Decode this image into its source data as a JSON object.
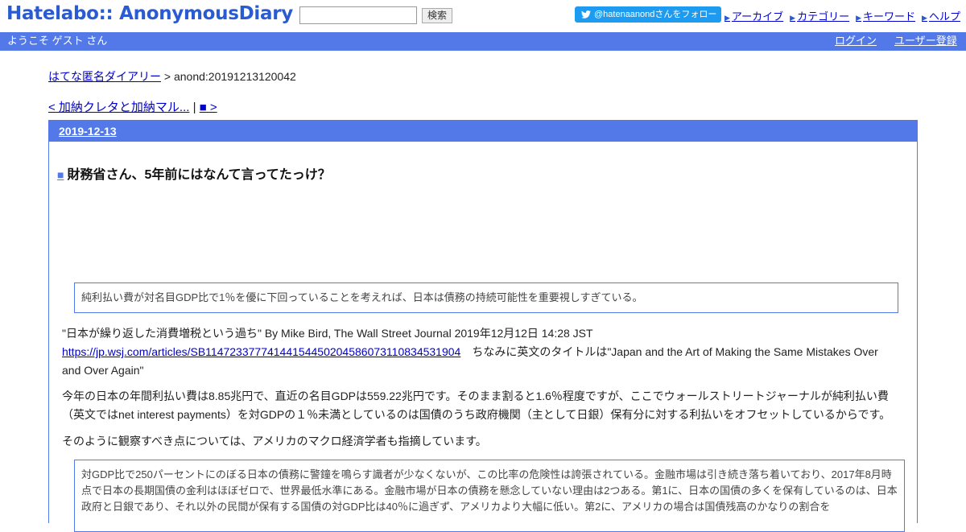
{
  "header": {
    "logo": "Hatelabo:: AnonymousDiary",
    "search_placeholder": "",
    "search_button": "検索",
    "follow_button": "@hatenaanondさんをフォロー",
    "links": [
      "アーカイブ",
      "カテゴリー",
      "キーワード",
      "ヘルプ"
    ]
  },
  "userbar": {
    "welcome": "ようこそ ゲスト さん",
    "login": "ログイン",
    "register": "ユーザー登録"
  },
  "breadcrumb": {
    "home": "はてな匿名ダイアリー",
    "separator": " > ",
    "current": "anond:20191213120042"
  },
  "pager": {
    "prev": "< 加納クレタと加納マル...",
    "separator": " | ",
    "next": "■ >"
  },
  "day": {
    "date": "2019-12-13"
  },
  "entry": {
    "title_mark": "■",
    "title": "財務省さん、5年前にはなんて言ってたっけ？",
    "quote1": "純利払い費が対名目GDP比で1％を優に下回っていることを考えれば、日本は債務の持続可能性を重要視しすぎている。",
    "para1_text": "\"日本が繰り返した消費増税という過ち\" By Mike Bird, The Wall Street Journal 2019年12月12日 14:28 JST",
    "para1_link": "https://jp.wsj.com/articles/SB11472337774144154450204586073110834531904",
    "para1_tail": "　ちなみに英文のタイトルは\"Japan and the Art of Making the Same Mistakes Over and Over Again\"",
    "para2": "今年の日本の年間利払い費は8.85兆円で、直近の名目GDPは559.22兆円です。そのまま割ると1.6％程度ですが、ここでウォールストリートジャーナルが純利払い費（英文ではnet interest payments）を対GDPの１％未満としているのは国債のうち政府機関（主として日銀）保有分に対する利払いをオフセットしているからです。",
    "para3": "そのように観察すべき点については、アメリカのマクロ経済学者も指摘しています。",
    "quote2": "対GDP比で250パーセントにのぼる日本の債務に警鐘を鳴らす識者が少なくないが、この比率の危険性は誇張されている。金融市場は引き続き落ち着いており、2017年8月時点で日本の長期国債の金利はほぼゼロで、世界最低水準にある。金融市場が日本の債務を懸念していない理由は2つある。第1に、日本の国債の多くを保有しているのは、日本政府と日銀であり、それ以外の民間が保有する国債の対GDP比は40％に過ぎず、アメリカより大幅に低い。第2に、アメリカの場合は国債残高のかなりの割合を"
  }
}
